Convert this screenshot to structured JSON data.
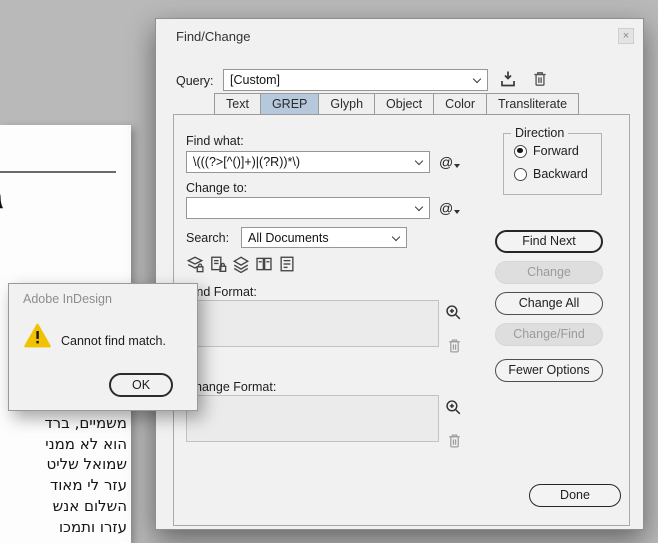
{
  "colors": {
    "desktop_bg": "#b9b9b9",
    "dialog_bg": "#f1f1f1",
    "page_bg": "#fdfdfd",
    "active_tab_bg": "#b5c8dc",
    "warning_yellow": "#f2c100",
    "default_button_border": "#262626"
  },
  "icons": {
    "close": "×",
    "save_query": "save-query-icon",
    "delete_query": "trash-icon",
    "scope": [
      "include-locked-layers-icon",
      "include-locked-stories-icon",
      "include-hidden-layers-icon",
      "include-master-pages-icon",
      "include-footnotes-icon"
    ],
    "specify_attributes": "magnifier-plus-icon",
    "clear_attributes": "trash-icon",
    "warning": "warning-triangle-icon"
  },
  "find_change": {
    "title": "Find/Change",
    "query": {
      "label": "Query:",
      "value": "[Custom]"
    },
    "tabs": [
      {
        "label": "Text",
        "active": false
      },
      {
        "label": "GREP",
        "active": true
      },
      {
        "label": "Glyph",
        "active": false
      },
      {
        "label": "Object",
        "active": false
      },
      {
        "label": "Color",
        "active": false
      },
      {
        "label": "Transliterate",
        "active": false
      }
    ],
    "find_what": {
      "label": "Find what:",
      "value": "\\(((?>[^()]+)|(?R))*\\)"
    },
    "change_to": {
      "label": "Change to:",
      "value": ""
    },
    "at_button": "@",
    "direction": {
      "label": "Direction",
      "options": [
        {
          "label": "Forward",
          "selected": true
        },
        {
          "label": "Backward",
          "selected": false
        }
      ]
    },
    "search": {
      "label": "Search:",
      "value": "All Documents"
    },
    "find_format_label": "Find Format:",
    "change_format_label": "Change Format:",
    "buttons": [
      {
        "label": "Find Next",
        "enabled": true,
        "default": true
      },
      {
        "label": "Change",
        "enabled": false
      },
      {
        "label": "Change All",
        "enabled": true
      },
      {
        "label": "Change/Find",
        "enabled": false
      },
      {
        "label": "Fewer Options",
        "enabled": true
      }
    ],
    "done_label": "Done"
  },
  "alert": {
    "title": "Adobe InDesign",
    "message": "Cannot find match.",
    "ok_label": "OK"
  },
  "document": {
    "fragment": "ג",
    "lines": [
      "משמיים, ברד",
      "הוא לא ממני",
      "שמואל שליט",
      "עזר לי מאוד",
      "השלום אנש",
      "עזרו ותמכו"
    ]
  }
}
